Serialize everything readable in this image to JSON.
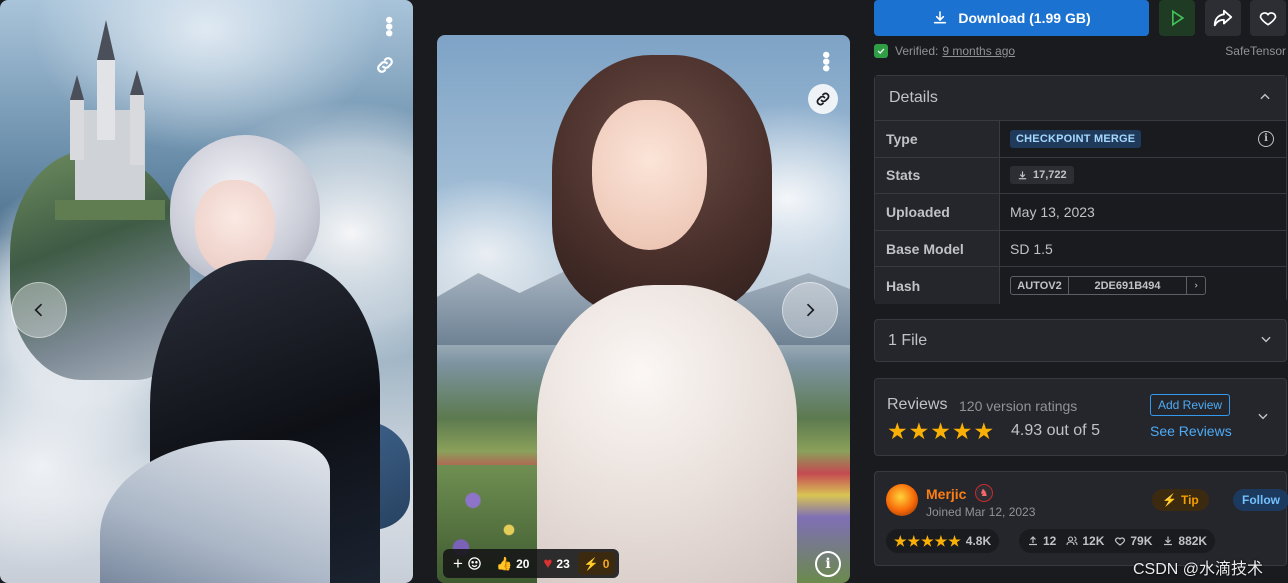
{
  "gallery": {
    "reactions": {
      "like": "20",
      "heart": "23",
      "buzz": "0"
    }
  },
  "actions": {
    "download_label": "Download (1.99 GB)",
    "verified_label": "Verified:",
    "verified_time": "9 months ago",
    "format": "SafeTensor"
  },
  "details": {
    "title": "Details",
    "rows": {
      "type_key": "Type",
      "type_val": "CHECKPOINT MERGE",
      "stats_key": "Stats",
      "stats_val": "17,722",
      "uploaded_key": "Uploaded",
      "uploaded_val": "May 13, 2023",
      "base_key": "Base Model",
      "base_val": "SD 1.5",
      "hash_key": "Hash",
      "hash_algo": "AUTOV2",
      "hash_val": "2DE691B494"
    }
  },
  "files": {
    "label": "1 File"
  },
  "reviews": {
    "title": "Reviews",
    "count": "120 version ratings",
    "rating": 4.93,
    "rating_text": "4.93 out of 5",
    "add_review": "Add Review",
    "see_reviews": "See Reviews"
  },
  "author": {
    "name": "Merjic",
    "joined": "Joined Mar 12, 2023",
    "tip": "Tip",
    "follow": "Follow",
    "rating": "4.8K",
    "uploads": "12",
    "followers": "12K",
    "likes": "79K",
    "downloads": "882K"
  },
  "watermark": "CSDN @水滴技术",
  "colors": {
    "accent": "#1c72d0",
    "star": "#fab005",
    "author": "#fd7e14",
    "run": "#40c057"
  }
}
